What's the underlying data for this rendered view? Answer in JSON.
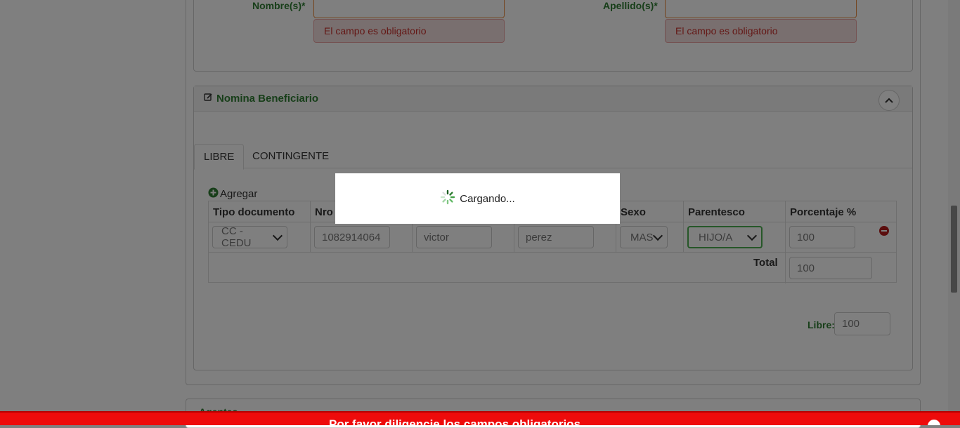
{
  "form": {
    "nombre_label": "Nombre(s)*",
    "apellido_label": "Apellido(s)*",
    "nombre_error": "El campo es obligatorio",
    "apellido_error": "El campo es obligatorio"
  },
  "nomina": {
    "title": "Nomina Beneficiario",
    "tabs": [
      "LIBRE",
      "CONTINGENTE"
    ],
    "agregar_label": "Agregar",
    "columns": [
      "Tipo documento",
      "Nro",
      "Sexo",
      "Parentesco",
      "Porcentaje %"
    ],
    "row": {
      "tipo_documento": "CC - CEDU",
      "nro": "1082914064",
      "nombre": "victor",
      "apellido": "perez",
      "sexo": "MAS",
      "parentesco": "HIJO/A",
      "porcentaje": "100"
    },
    "total_label": "Total",
    "total_value": "100",
    "libre_label": "Libre:",
    "libre_value": "100"
  },
  "next_panel_title": "Agentes",
  "loader_text": "Cargando...",
  "bottom_banner": "Por favor diligencie los campos obligatorios",
  "colors": {
    "green_label": "#2e7d32",
    "error_bg": "#f2dede",
    "error_text": "#c9302c",
    "banner": "#ee0b0b",
    "overlay": "rgba(0,0,0,0.5)"
  }
}
